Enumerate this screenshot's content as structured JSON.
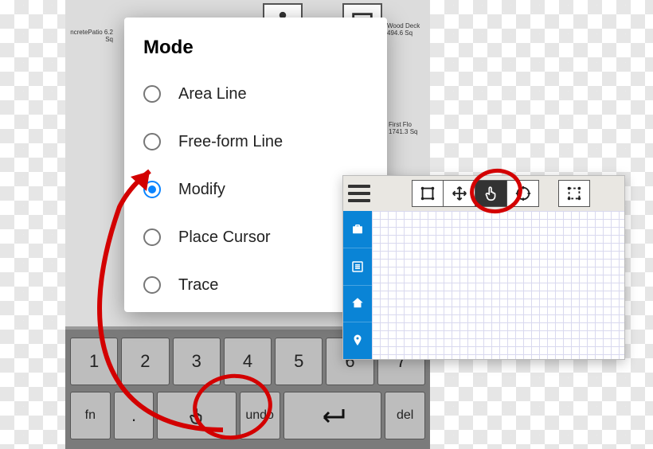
{
  "background": {
    "symbols": [
      "fan",
      "laundry"
    ],
    "labels": {
      "l1": "ncretePatio\n6.2 Sq",
      "l2": "Wood Deck\n494.6 Sq",
      "l3": "First Flo\n1741.3 Sq"
    }
  },
  "mode_dialog": {
    "title": "Mode",
    "options": [
      {
        "label": "Area Line",
        "selected": false
      },
      {
        "label": "Free-form Line",
        "selected": false
      },
      {
        "label": "Modify",
        "selected": true
      },
      {
        "label": "Place Cursor",
        "selected": false
      },
      {
        "label": "Trace",
        "selected": false
      }
    ]
  },
  "keyboard": {
    "row1": [
      "1",
      "2",
      "3",
      "4",
      "5",
      "6",
      "7"
    ],
    "row2": [
      {
        "label": "fn",
        "name": "fn-key"
      },
      {
        "label": ".",
        "name": "period-key"
      },
      {
        "label": "pointer",
        "name": "pointer-key",
        "wide": true,
        "icon": true
      },
      {
        "label": "undo",
        "name": "undo-key"
      },
      {
        "label": "enter",
        "name": "enter-key",
        "wide": true,
        "icon": true
      },
      {
        "label": "del",
        "name": "delete-key"
      }
    ]
  },
  "right_panel": {
    "tools_main": [
      {
        "name": "tool-select-box",
        "icon": "select-box"
      },
      {
        "name": "tool-move",
        "icon": "move"
      },
      {
        "name": "tool-pointer",
        "icon": "pointer",
        "active": true
      },
      {
        "name": "tool-target",
        "icon": "target"
      }
    ],
    "tools_extra": [
      {
        "name": "tool-dashed-box",
        "icon": "dashed-box"
      }
    ],
    "sidebar": [
      {
        "name": "side-briefcase",
        "icon": "briefcase-icon"
      },
      {
        "name": "side-list",
        "icon": "list-icon"
      },
      {
        "name": "side-home",
        "icon": "home-icon"
      },
      {
        "name": "side-pin",
        "icon": "pin-icon"
      }
    ]
  }
}
